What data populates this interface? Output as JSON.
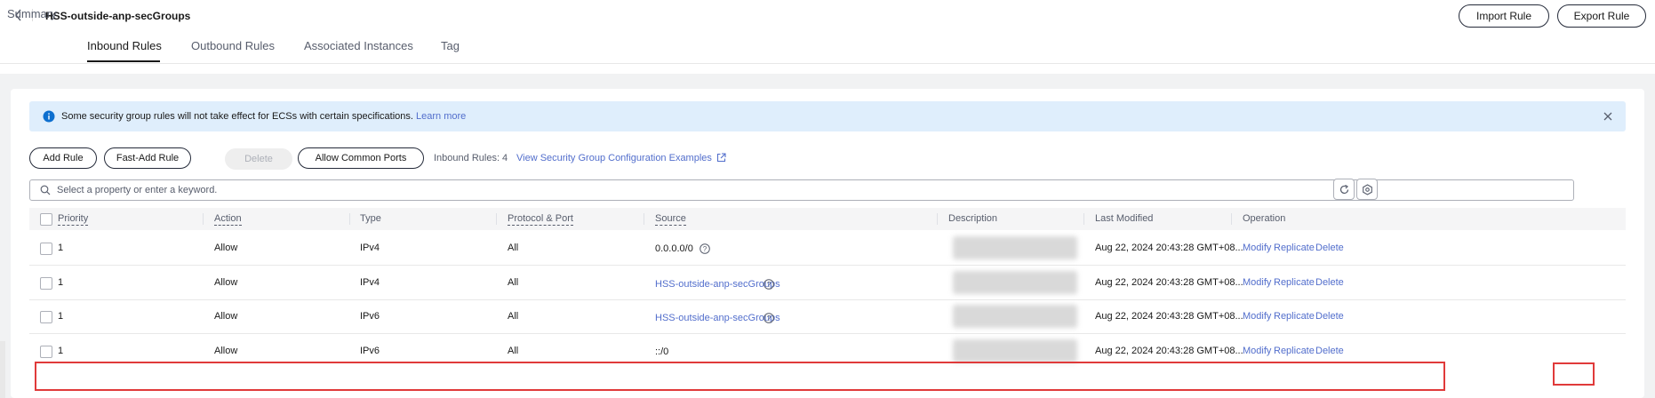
{
  "header": {
    "title": "HSS-outside-anp-secGroups",
    "import_label": "Import Rule",
    "export_label": "Export Rule"
  },
  "tabs": [
    {
      "label": "Summary"
    },
    {
      "label": "Inbound Rules",
      "active": true
    },
    {
      "label": "Outbound Rules"
    },
    {
      "label": "Associated Instances"
    },
    {
      "label": "Tag"
    }
  ],
  "notice": {
    "text": "Some security group rules will not take effect for ECSs with certain specifications.",
    "link": "Learn more"
  },
  "toolbar": {
    "add_rule": "Add Rule",
    "fast_add_rule": "Fast-Add Rule",
    "delete": "Delete",
    "allow_common_ports": "Allow Common Ports",
    "rules_count": "Inbound Rules: 4",
    "examples_link": "View Security Group Configuration Examples"
  },
  "search": {
    "placeholder": "Select a property or enter a keyword."
  },
  "table": {
    "columns": [
      "Priority",
      "Action",
      "Type",
      "Protocol & Port",
      "Source",
      "Description",
      "Last Modified",
      "Operation"
    ],
    "rows": [
      {
        "priority": "1",
        "action": "Allow",
        "type": "IPv4",
        "protocol": "All",
        "source": "0.0.0.0/0",
        "source_is_link": false,
        "last_modified": "Aug 22, 2024 20:43:28 GMT+08..."
      },
      {
        "priority": "1",
        "action": "Allow",
        "type": "IPv4",
        "protocol": "All",
        "source": "HSS-outside-anp-secGroups",
        "source_is_link": true,
        "last_modified": "Aug 22, 2024 20:43:28 GMT+08..."
      },
      {
        "priority": "1",
        "action": "Allow",
        "type": "IPv6",
        "protocol": "All",
        "source": "HSS-outside-anp-secGroups",
        "source_is_link": true,
        "last_modified": "Aug 22, 2024 20:43:28 GMT+08..."
      },
      {
        "priority": "1",
        "action": "Allow",
        "type": "IPv6",
        "protocol": "All",
        "source": "::/0",
        "source_is_link": false,
        "last_modified": "Aug 22, 2024 20:43:28 GMT+08..."
      }
    ],
    "operations": {
      "modify": "Modify",
      "replicate": "Replicate",
      "delete": "Delete"
    }
  },
  "colors": {
    "link": "#526ecc",
    "notice_bg": "#dfeefc",
    "highlight": "#e03a3a"
  },
  "icons": [
    "chevron-left-icon",
    "info-icon",
    "close-icon",
    "external-link-icon",
    "search-icon",
    "refresh-icon",
    "settings-icon",
    "help-icon"
  ]
}
